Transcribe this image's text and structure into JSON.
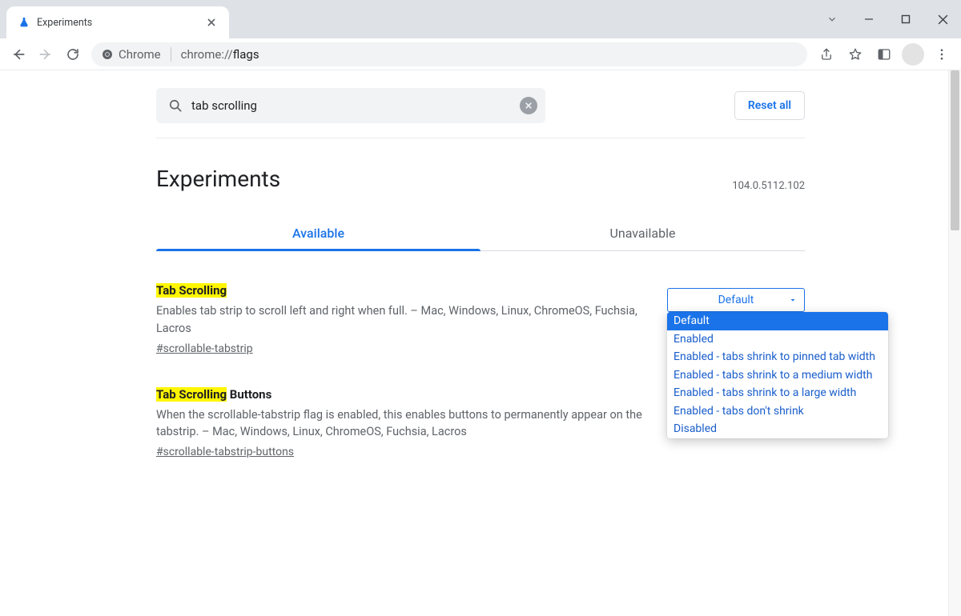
{
  "window": {
    "tab_title": "Experiments"
  },
  "omnibox": {
    "chip_label": "Chrome",
    "url_scheme": "chrome://",
    "url_path": "flags"
  },
  "page": {
    "search_value": "tab scrolling",
    "reset_label": "Reset all",
    "heading": "Experiments",
    "version": "104.0.5112.102",
    "tabs": {
      "available": "Available",
      "unavailable": "Unavailable"
    },
    "dropdown_selected": "Default",
    "dropdown_options": [
      "Default",
      "Enabled",
      "Enabled - tabs shrink to pinned tab width",
      "Enabled - tabs shrink to a medium width",
      "Enabled - tabs shrink to a large width",
      "Enabled - tabs don't shrink",
      "Disabled"
    ],
    "flags": [
      {
        "title_hl": "Tab Scrolling",
        "title_rest": "",
        "desc": "Enables tab strip to scroll left and right when full. – Mac, Windows, Linux, ChromeOS, Fuchsia, Lacros",
        "id": "#scrollable-tabstrip"
      },
      {
        "title_hl": "Tab Scrolling",
        "title_rest": " Buttons",
        "desc": "When the scrollable-tabstrip flag is enabled, this enables buttons to permanently appear on the tabstrip. – Mac, Windows, Linux, ChromeOS, Fuchsia, Lacros",
        "id": "#scrollable-tabstrip-buttons"
      }
    ]
  }
}
